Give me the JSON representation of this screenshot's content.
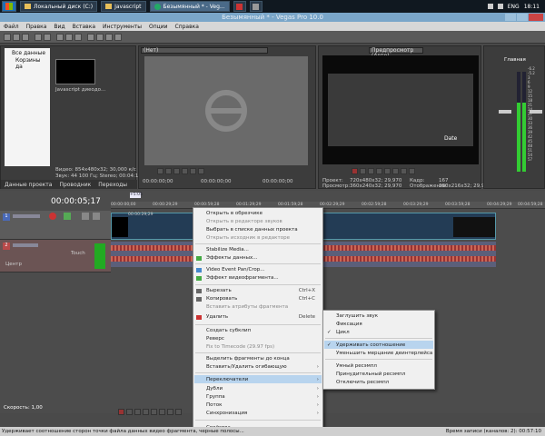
{
  "taskbar": {
    "items": [
      "Локальный диск (C:)",
      "Javascript",
      "Безымянный * - Veg..."
    ],
    "lang": "ENG",
    "clock": "18:11"
  },
  "window": {
    "title": "Безымянный * - Vegas Pro 10.0"
  },
  "menu": [
    "Файл",
    "Правка",
    "Вид",
    "Вставка",
    "Инструменты",
    "Опции",
    "Справка"
  ],
  "explorer": {
    "tree": [
      "Все данные",
      "Корзины да"
    ],
    "media_name": "Javascript диеодо...",
    "info": [
      "Видео: 854x480x32; 30,000 к/с",
      "Звук: 44 100 Гц; Stereo; 00:04:16;27"
    ],
    "tabs": [
      "Данные проекта",
      "Проводник",
      "Переходы"
    ]
  },
  "trimmer": {
    "dropdown": "(Нет)",
    "time1": "00:00:00;00",
    "time2": "00:00:00;00",
    "time3": "00:00:00;00"
  },
  "preview": {
    "mode": "Предпросмотр (Авто)",
    "overlay_text": "Date",
    "project_label": "Проект:",
    "project_val": "720x480x32; 29,970",
    "preview_label": "Просмотр:",
    "preview_val": "360x240x32; 29,970",
    "frame_label": "Кадр:",
    "frame_val": "167",
    "display_label": "Отображение:",
    "display_val": "380x216x32; 29,970"
  },
  "master": {
    "title": "Главная",
    "scale": [
      "-6.2",
      "-5.2",
      "3",
      "6",
      "9",
      "12",
      "15",
      "18",
      "21",
      "24",
      "27",
      "30",
      "33",
      "36",
      "39",
      "42",
      "45",
      "48",
      "51",
      "54",
      "57"
    ]
  },
  "timeline": {
    "timecode": "00:00:05;17",
    "marker": "+5:05",
    "ruler": [
      "00:00:00;00",
      "00:00:29;29",
      "00:00:59;28",
      "00:01:29;29",
      "00:01:59;28",
      "00:02:29;29",
      "00:02:59;28",
      "00:03:29;29",
      "00:03:59;28",
      "00:04:29;29",
      "00:04:59;28"
    ],
    "video_clip_label": "00:00:29;29",
    "audio_track": {
      "label": "Touch",
      "pan": "Центр"
    },
    "speed": "Скорость: 1,00",
    "record_time": "Время записи (каналов: 2): 00:57:10"
  },
  "context_menu": {
    "items": [
      {
        "label": "Открыть в обрезчике",
        "disabled": false
      },
      {
        "label": "Открыть в редакторе звуков",
        "disabled": true
      },
      {
        "label": "Выбрать в списке данных проекта",
        "disabled": false
      },
      {
        "label": "Открыть исходник в редакторе",
        "disabled": true
      },
      {
        "label": "Stabilize Media...",
        "disabled": false
      },
      {
        "label": "Эффекты данных...",
        "disabled": false
      },
      {
        "label": "Video Event Pan/Crop...",
        "disabled": false
      },
      {
        "label": "Эффект видеофрагмента...",
        "disabled": false
      },
      {
        "label": "Вырезать",
        "shortcut": "Ctrl+X",
        "disabled": false
      },
      {
        "label": "Копировать",
        "shortcut": "Ctrl+C",
        "disabled": false
      },
      {
        "label": "Вставить атрибуты фрагмента",
        "disabled": true
      },
      {
        "label": "Удалить",
        "shortcut": "Delete",
        "disabled": false
      },
      {
        "label": "Создать субклип",
        "disabled": false
      },
      {
        "label": "Реверс",
        "disabled": false
      },
      {
        "label": "Fix to Timecode (29.97 fps)",
        "disabled": true
      },
      {
        "label": "Выделить фрагменты до конца",
        "disabled": false
      },
      {
        "label": "Вставить/Удалить огибающую",
        "disabled": false
      },
      {
        "label": "Переключатели",
        "submenu": true,
        "highlight": true
      },
      {
        "label": "Дубли",
        "submenu": true
      },
      {
        "label": "Группа",
        "submenu": true
      },
      {
        "label": "Поток",
        "submenu": true
      },
      {
        "label": "Синхронизация",
        "submenu": true
      },
      {
        "label": "Свойства...",
        "disabled": false
      }
    ]
  },
  "submenu": {
    "items": [
      {
        "label": "Заглушить звук",
        "checked": false
      },
      {
        "label": "Фиксация",
        "checked": false
      },
      {
        "label": "Цикл",
        "checked": true
      },
      {
        "label": "Удерживать соотношение",
        "checked": true,
        "highlight": true
      },
      {
        "label": "Уменьшить мерцание деинтерлейса",
        "checked": false
      },
      {
        "label": "Умный ресэмпл",
        "checked": false
      },
      {
        "label": "Принудительный ресэмпл",
        "checked": false
      },
      {
        "label": "Отключить ресэмпл",
        "checked": false
      }
    ]
  },
  "status": "Удерживает соотношение сторон точки файла данных видео фрагмента, черные полосы..."
}
